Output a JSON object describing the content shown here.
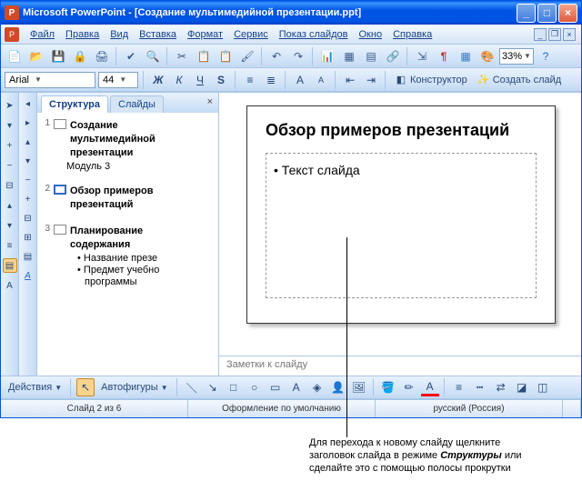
{
  "titlebar": {
    "app": "Microsoft PowerPoint",
    "doc": "[Создание мультимедийной презентации.ppt]"
  },
  "menu": {
    "file": "Файл",
    "edit": "Правка",
    "view": "Вид",
    "insert": "Вставка",
    "format": "Формат",
    "tools": "Сервис",
    "slideshow": "Показ слайдов",
    "window": "Окно",
    "help": "Справка"
  },
  "zoom": "33%",
  "font": {
    "name": "Arial",
    "size": "44"
  },
  "fmtbuttons": {
    "designer": "Конструктор",
    "newslide": "Создать слайд"
  },
  "tabs": {
    "outline": "Структура",
    "slides": "Слайды"
  },
  "outline": {
    "s1": {
      "num": "1",
      "title1": "Создание",
      "title2": "мультимедийной",
      "title3": "презентации",
      "sub": "Модуль 3"
    },
    "s2": {
      "num": "2",
      "title1": "Обзор примеров",
      "title2": "презентаций"
    },
    "s3": {
      "num": "3",
      "title1": "Планирование",
      "title2": "содержания",
      "b1": "Название презе",
      "b2": "Предмет учебно",
      "b3": "программы"
    }
  },
  "slide": {
    "title": "Обзор примеров презентаций",
    "bullet": "Текст слайда"
  },
  "notes": "Заметки к слайду",
  "drawbar": {
    "actions": "Действия",
    "autoshapes": "Автофигуры"
  },
  "status": {
    "slide": "Слайд 2 из 6",
    "design": "Оформление по умолчанию",
    "lang": "русский (Россия)"
  },
  "annotation": {
    "l1": "Для перехода к новому слайду щелкните",
    "l2a": "заголовок слайда в режиме ",
    "l2b": "Структуры",
    "l2c": " или",
    "l3": "сделайте это с помощью полосы прокрутки"
  }
}
